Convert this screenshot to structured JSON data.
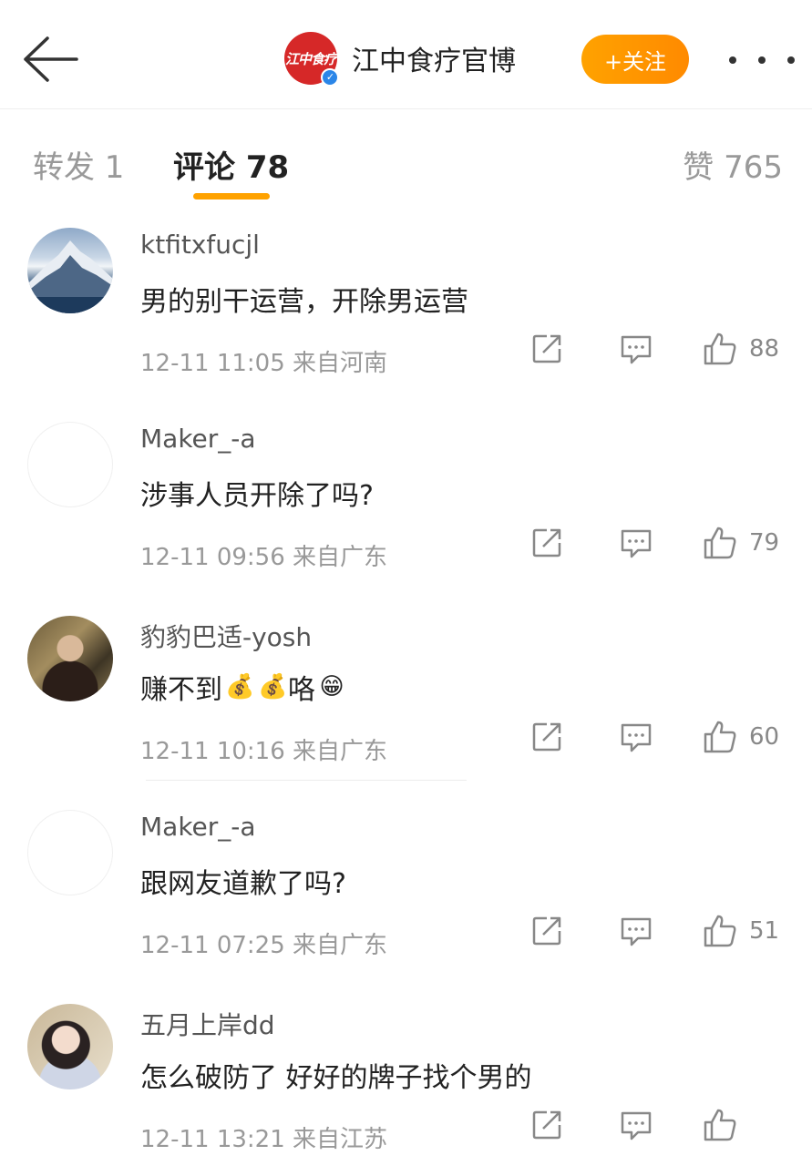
{
  "header": {
    "back_icon": "arrow-left-icon",
    "logo_text": "江中食疗",
    "verified_mark": "✓",
    "account_name": "江中食疗官博",
    "follow_label": "+关注",
    "more_icon": "more-horizontal-icon",
    "accent_color": "#ff9a00"
  },
  "tabs": {
    "repost": "转发 1",
    "comments": "评论 78",
    "likes": "赞 765"
  },
  "comments": [
    {
      "name": "ktfitxfucjl",
      "text": "男的别干运营，开除男运营",
      "meta": "12-11 11:05 来自河南",
      "likes": "88",
      "avatar": "mountain"
    },
    {
      "name": "Maker_-a",
      "text": "涉事人员开除了吗?",
      "meta": "12-11 09:56 来自广东",
      "likes": "79",
      "avatar": "blank"
    },
    {
      "name": "豹豹巴适-yosh",
      "text_before": "赚不到",
      "emoji_1": "💰",
      "emoji_2": "💰",
      "text_after": "咯",
      "emoji_3": "😁",
      "meta": "12-11 10:16 来自广东",
      "likes": "60",
      "avatar": "man"
    },
    {
      "name": "Maker_-a",
      "text": "跟网友道歉了吗?",
      "meta": "12-11 07:25 来自广东",
      "likes": "51",
      "avatar": "blank"
    },
    {
      "name": "五月上岸dd",
      "text": "怎么破防了 好好的牌子找个男的",
      "meta": "12-11 13:21 来自江苏",
      "likes": "",
      "avatar": "girl"
    }
  ]
}
